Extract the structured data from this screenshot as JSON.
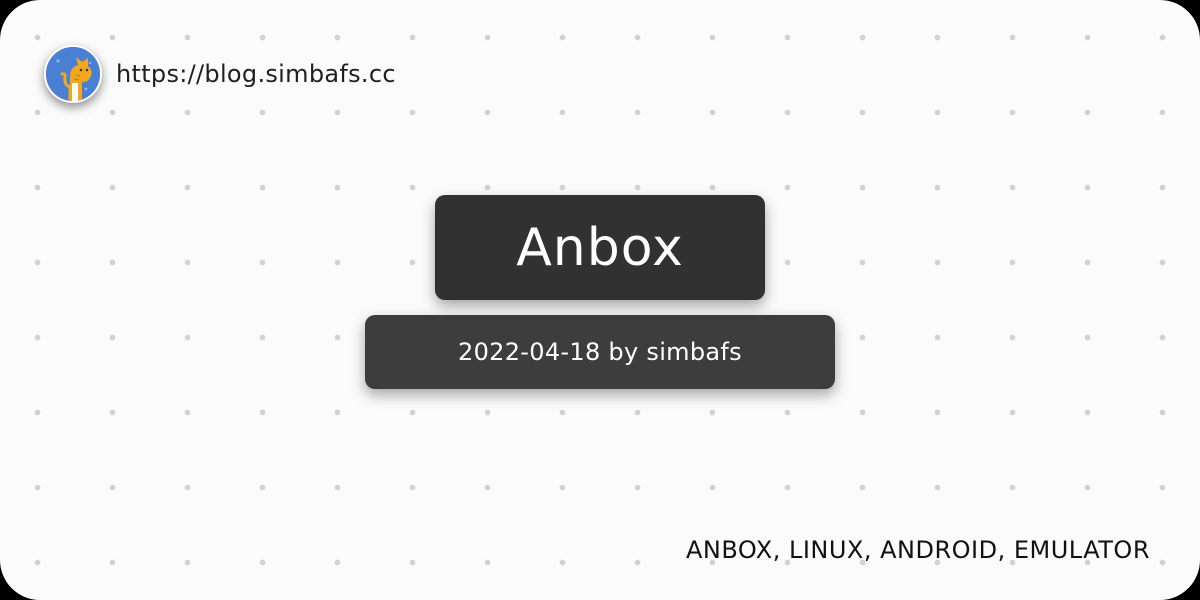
{
  "site": {
    "url": "https://blog.simbafs.cc",
    "avatar_icon": "cat-avatar-icon"
  },
  "post": {
    "title": "Anbox",
    "meta": "2022-04-18 by simbafs",
    "tags": "ANBOX, LINUX, ANDROID, EMULATOR"
  },
  "colors": {
    "background": "#fbfbfb",
    "dot": "#d2d2d2",
    "title_box": "#313131",
    "meta_box": "#3d3d3d",
    "avatar_bg": "#4a7fd6",
    "avatar_cat": "#f2a81d"
  }
}
